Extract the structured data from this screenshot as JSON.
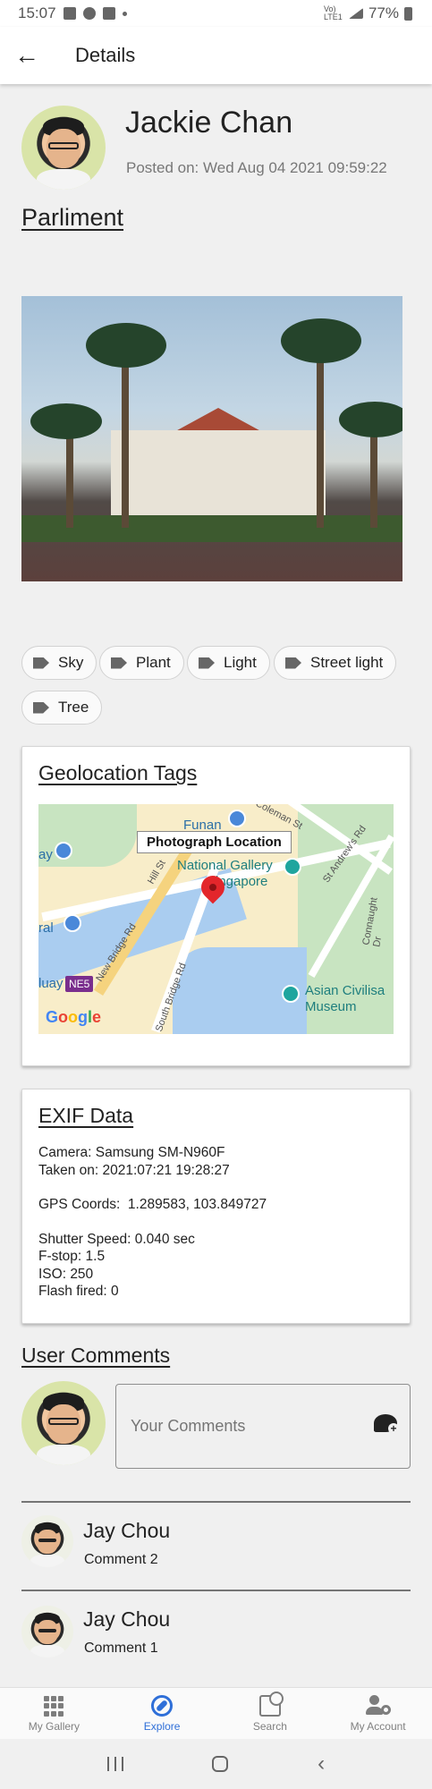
{
  "status_bar": {
    "time": "15:07",
    "icons_left": [
      "gallery-icon",
      "a-icon",
      "chat-icon",
      "dot-icon"
    ],
    "network": "Vo) LTE1",
    "battery": "77%"
  },
  "app_bar": {
    "back_icon": "arrow-left-icon",
    "back_glyph": "←",
    "title": "Details"
  },
  "post": {
    "author": "Jackie Chan",
    "posted_on": "Posted on: Wed Aug 04 2021 09:59:22",
    "title": "Parliment"
  },
  "tags": [
    {
      "label": "Sky"
    },
    {
      "label": "Plant"
    },
    {
      "label": "Light"
    },
    {
      "label": "Street light"
    },
    {
      "label": "Tree"
    }
  ],
  "geolocation": {
    "title": "Geolocation Tags",
    "tooltip": "Photograph Location",
    "labels": {
      "funan": "Funan",
      "coleman": "Coleman St",
      "national_gallery": "National Gallery",
      "singapore": "ingapore",
      "st_andrews": "St Andrew's Rd",
      "hill_st": "Hill St",
      "new_bridge": "New Bridge Rd",
      "connaught": "Connaught Dr",
      "south_bridge": "South Bridge Rd",
      "asian_civ": "Asian Civilisa",
      "museum": "Museum",
      "ay": "ay",
      "ral": "ral",
      "quay": "luay",
      "ne5": "NE5"
    },
    "google": [
      "G",
      "o",
      "o",
      "g",
      "l",
      "e"
    ]
  },
  "exif": {
    "title": "EXIF Data",
    "camera": "Camera: Samsung SM-N960F",
    "taken_on": "Taken on: 2021:07:21 19:28:27",
    "gps": "GPS Coords:  1.289583, 103.849727",
    "shutter": "Shutter Speed: 0.040 sec",
    "fstop": "F-stop: 1.5",
    "iso": "ISO: 250",
    "flash": "Flash fired: 0"
  },
  "comments_section": {
    "title": "User Comments",
    "input_placeholder": "Your Comments",
    "send_icon": "add-comment-icon",
    "send_plus": "+"
  },
  "comments": [
    {
      "author": "Jay Chou",
      "text": "Comment 2"
    },
    {
      "author": "Jay Chou",
      "text": "Comment 1"
    }
  ],
  "bottom_nav": [
    {
      "label": "My Gallery",
      "icon": "apps-grid-icon",
      "active": false
    },
    {
      "label": "Explore",
      "icon": "compass-icon",
      "active": true
    },
    {
      "label": "Search",
      "icon": "image-search-icon",
      "active": false
    },
    {
      "label": "My Account",
      "icon": "account-settings-icon",
      "active": false
    }
  ],
  "system_nav": {
    "back_glyph": "‹"
  },
  "colors": {
    "accent": "#2f6fd8",
    "background": "#f0f0f0",
    "map_pin": "#e3262b"
  }
}
